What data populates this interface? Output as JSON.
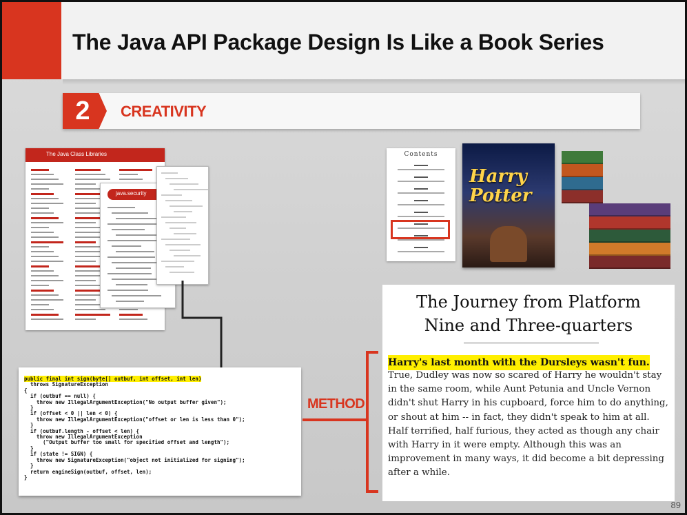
{
  "title": "The Java API Package Design Is Like a Book Series",
  "section": {
    "number": "2",
    "label": "CREATIVITY"
  },
  "api_doc": {
    "header": "The Java Class Libraries",
    "detail_label": "java.security"
  },
  "code": {
    "first_line": "public final int sign(byte[] outbuf, int offset, int len)",
    "rest": "  throws SignatureException\n{\n  if (outbuf == null) {\n    throw new IllegalArgumentException(\"No output buffer given\");\n  }\n  if (offset < 0 || len < 0) {\n    throw new IllegalArgumentException(\"offset or len is less than 0\");\n  }\n  if (outbuf.length - offset < len) {\n    throw new IllegalArgumentException\n      (\"Output buffer too small for specified offset and length\");\n  }\n  if (state != SIGN) {\n    throw new SignatureException(\"object not initialized for signing\");\n  }\n  return engineSign(outbuf, offset, len);\n}"
  },
  "callout": {
    "label": "METHOD"
  },
  "book": {
    "contents_title": "Contents",
    "cover_title_line1": "Harry",
    "cover_title_line2": "Potter"
  },
  "chapter": {
    "title_line1": "The Journey from Platform",
    "title_line2": "Nine and Three-quarters",
    "first_sentence": "Harry's last month with the Dursleys wasn't fun.",
    "body": "True, Dudley was now so scared of Harry he wouldn't stay in the same room, while Aunt Petunia and Uncle Vernon didn't shut Harry in his cupboard, force him to do anything, or shout at him -- in fact, they didn't speak to him at all. Half terrified, half furious, they acted as though any chair with Harry in it were empty. Although this was an improvement in many ways, it did become a bit depressing after a while."
  },
  "page_number": "89",
  "colors": {
    "accent": "#d8351f",
    "highlight": "#ffef00"
  }
}
